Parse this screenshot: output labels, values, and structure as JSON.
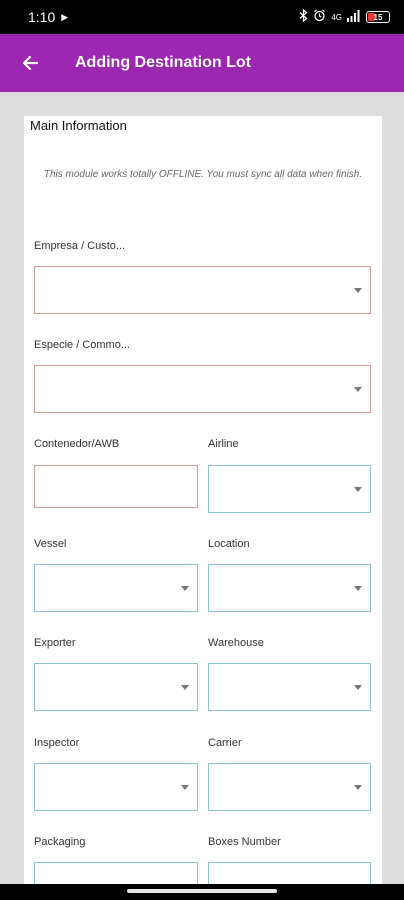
{
  "status_bar": {
    "time": "1:10",
    "network": "4G",
    "battery": "15"
  },
  "app_bar": {
    "title": "Adding Destination Lot"
  },
  "form": {
    "section_title": "Main Information",
    "offline_note": "This module works totally OFFLINE. You must sync all data when finish.",
    "fields": {
      "empresa": {
        "label": "Empresa / Custo..."
      },
      "especie": {
        "label": "Especie / Commo..."
      },
      "contenedor": {
        "label": "Contenedor/AWB"
      },
      "airline": {
        "label": "Airline"
      },
      "vessel": {
        "label": "Vessel"
      },
      "location": {
        "label": "Location"
      },
      "exporter": {
        "label": "Exporter"
      },
      "warehouse": {
        "label": "Warehouse"
      },
      "inspector": {
        "label": "Inspector"
      },
      "carrier": {
        "label": "Carrier"
      },
      "packaging": {
        "label": "Packaging"
      },
      "boxes_number": {
        "label": "Boxes Number"
      }
    }
  },
  "colors": {
    "app_bar": "#9c27b0",
    "invalid_border": "#d99a9a",
    "valid_border": "#8fc3cf",
    "background": "#dcdcdc"
  }
}
